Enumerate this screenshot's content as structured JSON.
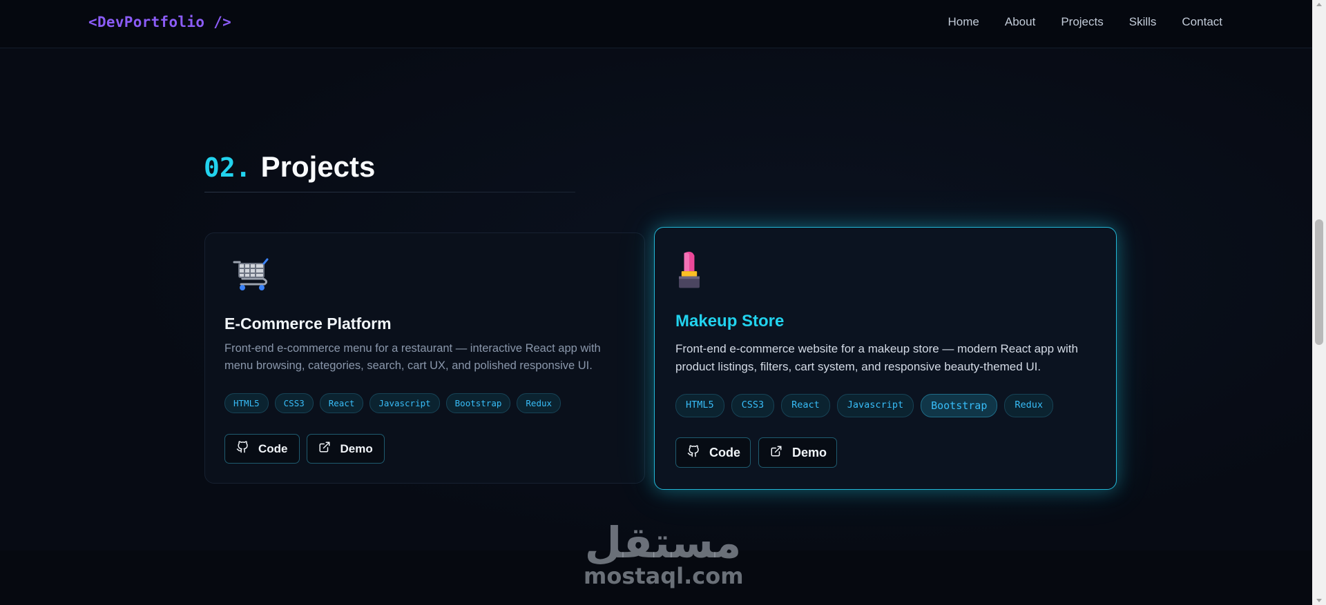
{
  "nav": {
    "brand": "<DevPortfolio />",
    "links": [
      "Home",
      "About",
      "Projects",
      "Skills",
      "Contact"
    ]
  },
  "section": {
    "number": "02.",
    "title": "Projects"
  },
  "projects": [
    {
      "icon": "shopping-cart-icon",
      "title": "E-Commerce Platform",
      "description": "Front-end e-commerce menu for a restaurant — interactive React app with menu browsing, categories, search, cart UX, and polished responsive UI.",
      "tags": [
        "HTML5",
        "CSS3",
        "React",
        "Javascript",
        "Bootstrap",
        "Redux"
      ],
      "code_label": "Code",
      "demo_label": "Demo"
    },
    {
      "icon": "lipstick-icon",
      "title": "Makeup Store",
      "description": "Front-end e-commerce website for a makeup store — modern React app with product listings, filters, cart system, and responsive beauty-themed UI.",
      "tags": [
        "HTML5",
        "CSS3",
        "React",
        "Javascript",
        "Bootstrap",
        "Redux"
      ],
      "code_label": "Code",
      "demo_label": "Demo"
    }
  ],
  "watermark": {
    "arabic": "مستقل",
    "latin": "mostaql.com"
  },
  "colors": {
    "accent": "#22d3ee",
    "brand": "#8b5cf6",
    "background": "#070b14"
  }
}
